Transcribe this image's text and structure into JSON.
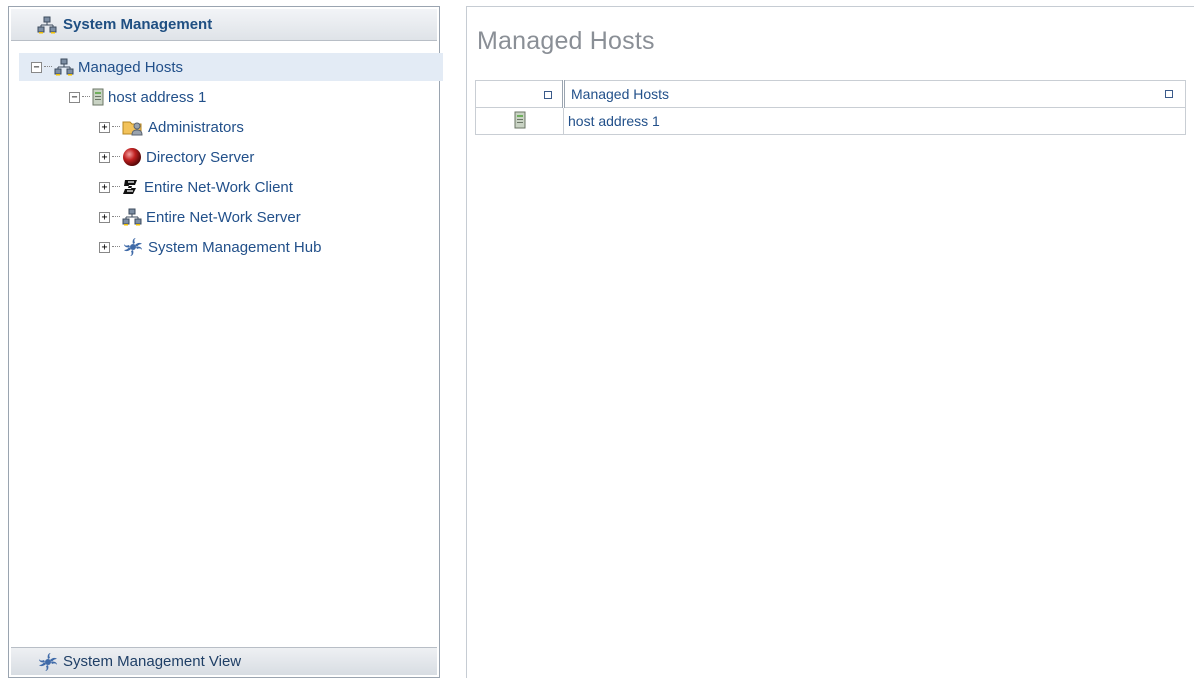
{
  "left_panel": {
    "header_title": "System Management",
    "tree": [
      {
        "label": "Managed Hosts",
        "toggle": "−",
        "icon": "network-icon",
        "selected": true
      },
      {
        "label": "host address 1",
        "toggle": "−",
        "icon": "server-icon"
      },
      {
        "label": "Administrators",
        "toggle": "+",
        "icon": "admin-folder-icon"
      },
      {
        "label": "Directory Server",
        "toggle": "+",
        "icon": "red-sphere-icon"
      },
      {
        "label": "Entire Net-Work Client",
        "toggle": "+",
        "icon": "netclient-icon"
      },
      {
        "label": "Entire Net-Work Server",
        "toggle": "+",
        "icon": "network-icon"
      },
      {
        "label": "System Management Hub",
        "toggle": "+",
        "icon": "smh-icon"
      }
    ],
    "footer_label": "System Management View"
  },
  "main": {
    "title": "Managed Hosts",
    "table": {
      "column_header": "Managed Hosts",
      "rows": [
        {
          "icon": "server-icon",
          "name": "host address 1"
        }
      ]
    }
  }
}
